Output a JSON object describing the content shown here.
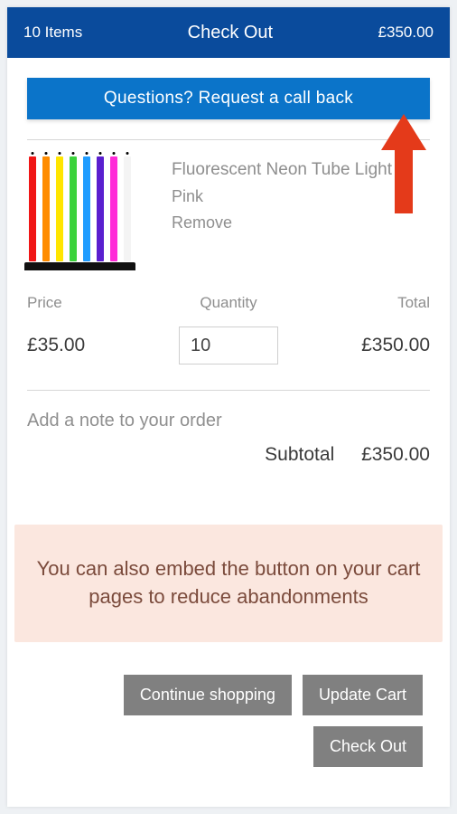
{
  "header": {
    "items_text": "10 Items",
    "title": "Check Out",
    "total": "£350.00"
  },
  "callback_label": "Questions? Request a call back",
  "product": {
    "title": "Fluorescent Neon Tube Light",
    "variant": "Pink",
    "remove_label": "Remove",
    "tube_colors": [
      "#f01616",
      "#ff8c00",
      "#ffe500",
      "#3bd23b",
      "#1f9cff",
      "#5a1fcf",
      "#ff2bd8",
      "#f4f4f4"
    ]
  },
  "columns": {
    "price_label": "Price",
    "quantity_label": "Quantity",
    "total_label": "Total"
  },
  "values": {
    "price": "£35.00",
    "quantity": "10",
    "line_total": "£350.00"
  },
  "note_placeholder": "Add a note to your order",
  "subtotal": {
    "label": "Subtotal",
    "value": "£350.00"
  },
  "overlay_text": "You can also embed the button on your cart pages to reduce abandonments",
  "buttons": {
    "continue": "Continue shopping",
    "update": "Update Cart",
    "checkout": "Check Out"
  }
}
